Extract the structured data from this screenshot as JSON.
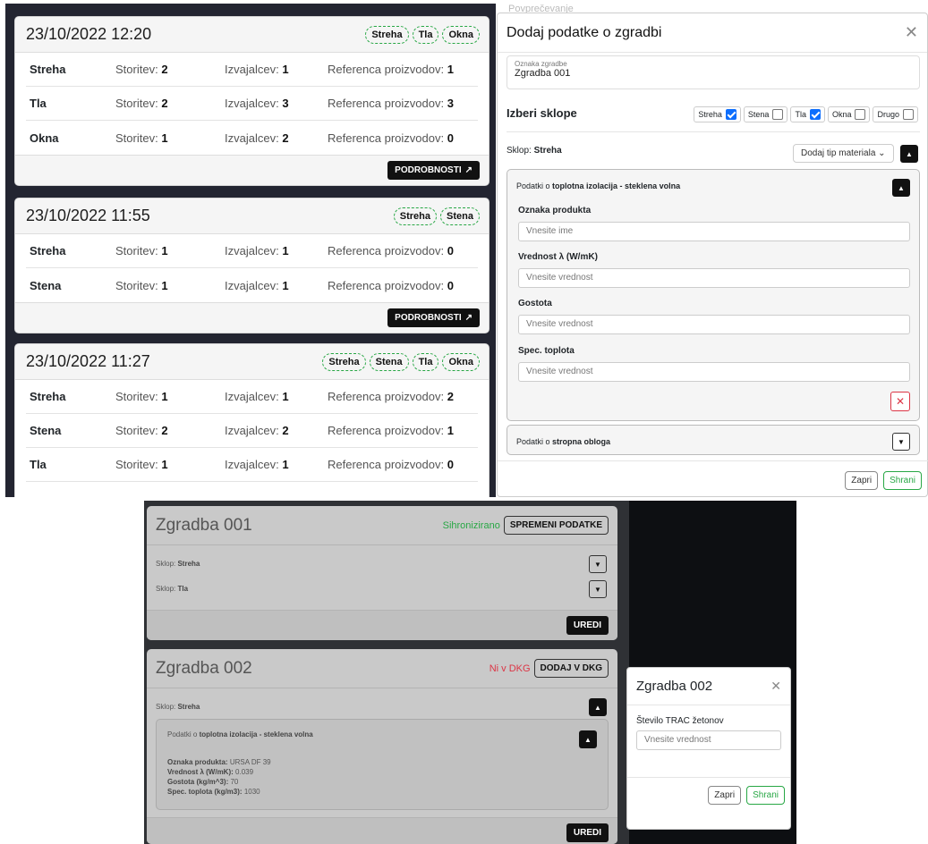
{
  "reports": [
    {
      "date": "23/10/2022 12:20",
      "tags": [
        "Streha",
        "Tla",
        "Okna"
      ],
      "rows": [
        {
          "name": "Streha",
          "storitev": "2",
          "izvajalcev": "1",
          "referenca": "1"
        },
        {
          "name": "Tla",
          "storitev": "2",
          "izvajalcev": "3",
          "referenca": "3"
        },
        {
          "name": "Okna",
          "storitev": "1",
          "izvajalcev": "2",
          "referenca": "0"
        }
      ]
    },
    {
      "date": "23/10/2022 11:55",
      "tags": [
        "Streha",
        "Stena"
      ],
      "rows": [
        {
          "name": "Streha",
          "storitev": "1",
          "izvajalcev": "1",
          "referenca": "0"
        },
        {
          "name": "Stena",
          "storitev": "1",
          "izvajalcev": "1",
          "referenca": "0"
        }
      ]
    },
    {
      "date": "23/10/2022 11:27",
      "tags": [
        "Streha",
        "Stena",
        "Tla",
        "Okna"
      ],
      "rows": [
        {
          "name": "Streha",
          "storitev": "1",
          "izvajalcev": "1",
          "referenca": "2"
        },
        {
          "name": "Stena",
          "storitev": "2",
          "izvajalcev": "2",
          "referenca": "1"
        },
        {
          "name": "Tla",
          "storitev": "1",
          "izvajalcev": "1",
          "referenca": "0"
        }
      ]
    }
  ],
  "labels": {
    "storitev": "Storitev:",
    "izvajalcev": "Izvajalcev:",
    "referenca": "Referenca proizvodov:",
    "details": "PODROBNOSTI"
  },
  "modal": {
    "title": "Dodaj podatke o zgradbi",
    "partial_header": "Povprečevanje",
    "oznaka_label": "Oznaka zgradbe",
    "oznaka_value": "Zgradba 001",
    "izberi": "Izberi sklope",
    "checks": [
      {
        "label": "Streha",
        "on": true
      },
      {
        "label": "Stena",
        "on": false
      },
      {
        "label": "Tla",
        "on": true
      },
      {
        "label": "Okna",
        "on": false
      },
      {
        "label": "Drugo",
        "on": false
      }
    ],
    "sklop_prefix": "Sklop:",
    "sklop": "Streha",
    "material_select": "Dodaj tip materiala",
    "podatki_prefix": "Podatki o",
    "material1": "toplotna izolacija - steklena volna",
    "material2": "stropna obloga",
    "fields": [
      {
        "label": "Oznaka produkta",
        "ph": "Vnesite ime"
      },
      {
        "label": "Vrednost λ (W/mK)",
        "ph": "Vnesite vrednost"
      },
      {
        "label": "Gostota",
        "ph": "Vnesite vrednost"
      },
      {
        "label": "Spec. toplota",
        "ph": "Vnesite vrednost"
      }
    ],
    "close": "Zapri",
    "save": "Shrani"
  },
  "buildings": [
    {
      "title": "Zgradba 001",
      "status": "Sihronizirano",
      "status_color": "#28a745",
      "action": "SPREMENI PODATKE",
      "sklopi": [
        "Streha",
        "Tla"
      ],
      "edit": "UREDI"
    },
    {
      "title": "Zgradba 002",
      "status": "Ni v DKG",
      "status_color": "#dc3545",
      "action": "DODAJ V DKG",
      "sklop": "Streha",
      "edit": "UREDI",
      "details": [
        {
          "k": "Oznaka produkta",
          "v": "URSA DF 39"
        },
        {
          "k": "Vrednost λ (W/mK)",
          "v": "0.039"
        },
        {
          "k": "Gostota (kg/m^3)",
          "v": "70"
        },
        {
          "k": "Spec. toplota (kg/m3)",
          "v": "1030"
        }
      ]
    }
  ],
  "modal2": {
    "title": "Zgradba 002",
    "label": "Število TRAC žetonov",
    "ph": "Vnesite vrednost",
    "close": "Zapri",
    "save": "Shrani"
  }
}
